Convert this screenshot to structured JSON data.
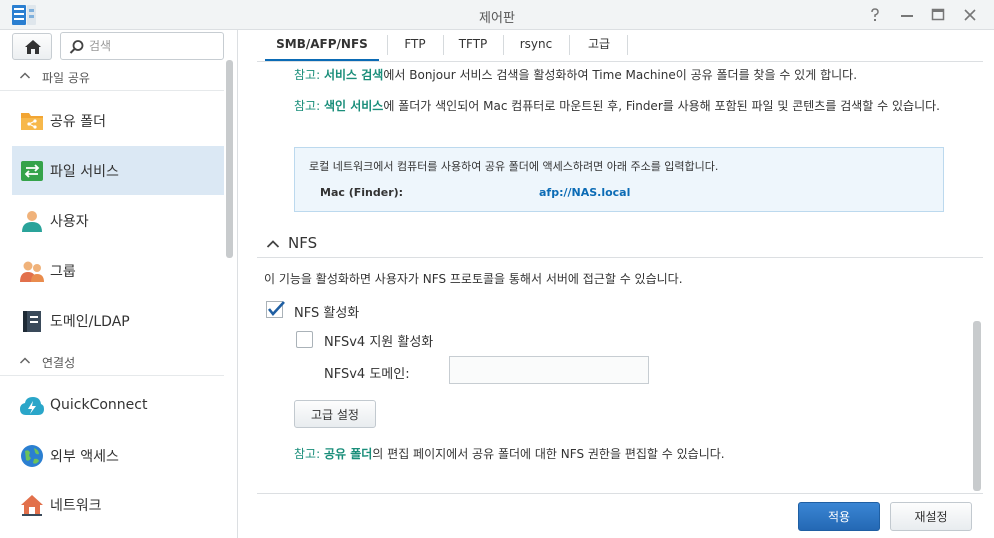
{
  "window": {
    "title": "제어판",
    "controls": [
      "help-icon",
      "minimize-icon",
      "maximize-icon",
      "close-icon"
    ]
  },
  "sidebar": {
    "search_placeholder": "검색",
    "sections": [
      {
        "label": "파일 공유",
        "items": [
          {
            "label": "공유 폴더",
            "icon": "shared-folder-icon"
          },
          {
            "label": "파일 서비스",
            "icon": "file-services-icon",
            "active": true
          },
          {
            "label": "사용자",
            "icon": "user-icon"
          },
          {
            "label": "그룹",
            "icon": "group-icon"
          },
          {
            "label": "도메인/LDAP",
            "icon": "domain-ldap-icon"
          }
        ]
      },
      {
        "label": "연결성",
        "items": [
          {
            "label": "QuickConnect",
            "icon": "quickconnect-icon"
          },
          {
            "label": "외부 액세스",
            "icon": "external-access-icon"
          },
          {
            "label": "네트워크",
            "icon": "network-icon"
          }
        ]
      }
    ]
  },
  "tabs": [
    {
      "label": "SMB/AFP/NFS",
      "active": true
    },
    {
      "label": "FTP"
    },
    {
      "label": "TFTP"
    },
    {
      "label": "rsync"
    },
    {
      "label": "고급"
    }
  ],
  "content": {
    "note1": {
      "prefix": "참고:",
      "bold": "서비스 검색",
      "text": "에서 Bonjour 서비스 검색을 활성화하여 Time Machine이 공유 폴더를 찾을 수 있게 합니다."
    },
    "note2": {
      "prefix": "참고:",
      "bold": "색인 서비스",
      "text": "에 폴더가 색인되어 Mac 컴퓨터로 마운트된 후, Finder를 사용해 포함된 파일 및 콘텐츠를 검색할 수 있습",
      "text2": "니다."
    },
    "info_box": {
      "description": "로컬 네트워크에서 컴퓨터를 사용하여 공유 폴더에 액세스하려면 아래 주소를 입력합니다.",
      "key": "Mac (Finder):",
      "value": "afp://NAS.local"
    },
    "nfs": {
      "section_title": "NFS",
      "description": "이 기능을 활성화하면 사용자가 NFS 프로토콜을 통해서 서버에 접근할 수 있습니다.",
      "enable_label": "NFS 활성화",
      "enable_checked": true,
      "nfsv4_label": "NFSv4 지원 활성화",
      "nfsv4_checked": false,
      "domain_label": "NFSv4 도메인:",
      "domain_value": "",
      "advanced_button": "고급 설정",
      "note": {
        "prefix": "참고:",
        "bold": "공유 폴더",
        "text": "의 편집 페이지에서 공유 폴더에 대한 NFS 권한을 편집할 수 있습니다."
      }
    }
  },
  "footer": {
    "apply_label": "적용",
    "reset_label": "재설정"
  },
  "colors": {
    "accent": "#0b6bb5",
    "note_highlight": "#1a8e7a",
    "apply_button": "#2d74c0",
    "active_sidebar": "#dbe8f4"
  }
}
